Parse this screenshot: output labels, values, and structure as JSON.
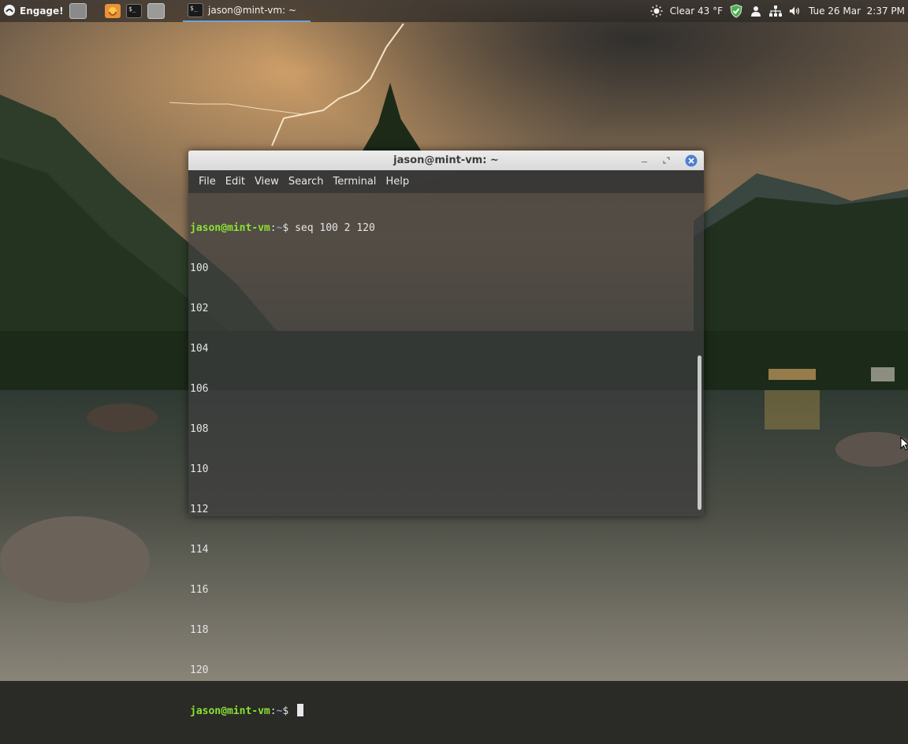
{
  "panel": {
    "menu_label": "Engage!",
    "task_terminal_title": "jason@mint-vm: ~",
    "weather": "Clear 43 °F",
    "clock": "Tue 26 Mar  2:37 PM"
  },
  "icons": {
    "menu": "mint-logo-icon",
    "show_desktop": "show-desktop-icon",
    "firefox": "firefox-icon",
    "terminal": "terminal-icon",
    "files": "folder-icon",
    "weather": "sun-icon",
    "shield": "shield-check-icon",
    "user": "user-icon",
    "network": "network-icon",
    "volume": "volume-icon"
  },
  "terminal": {
    "title": "jason@mint-vm: ~",
    "menu": [
      "File",
      "Edit",
      "View",
      "Search",
      "Terminal",
      "Help"
    ],
    "prompt_user": "jason@mint-vm",
    "prompt_sep": ":",
    "prompt_path": "~",
    "prompt_symbol": "$ ",
    "command": "seq 100 2 120",
    "output": [
      "100",
      "102",
      "104",
      "106",
      "108",
      "110",
      "112",
      "114",
      "116",
      "118",
      "120"
    ]
  },
  "colors": {
    "prompt_user": "#8ae234",
    "prompt_path": "#729fcf",
    "close_button": "#4a7fd1"
  }
}
